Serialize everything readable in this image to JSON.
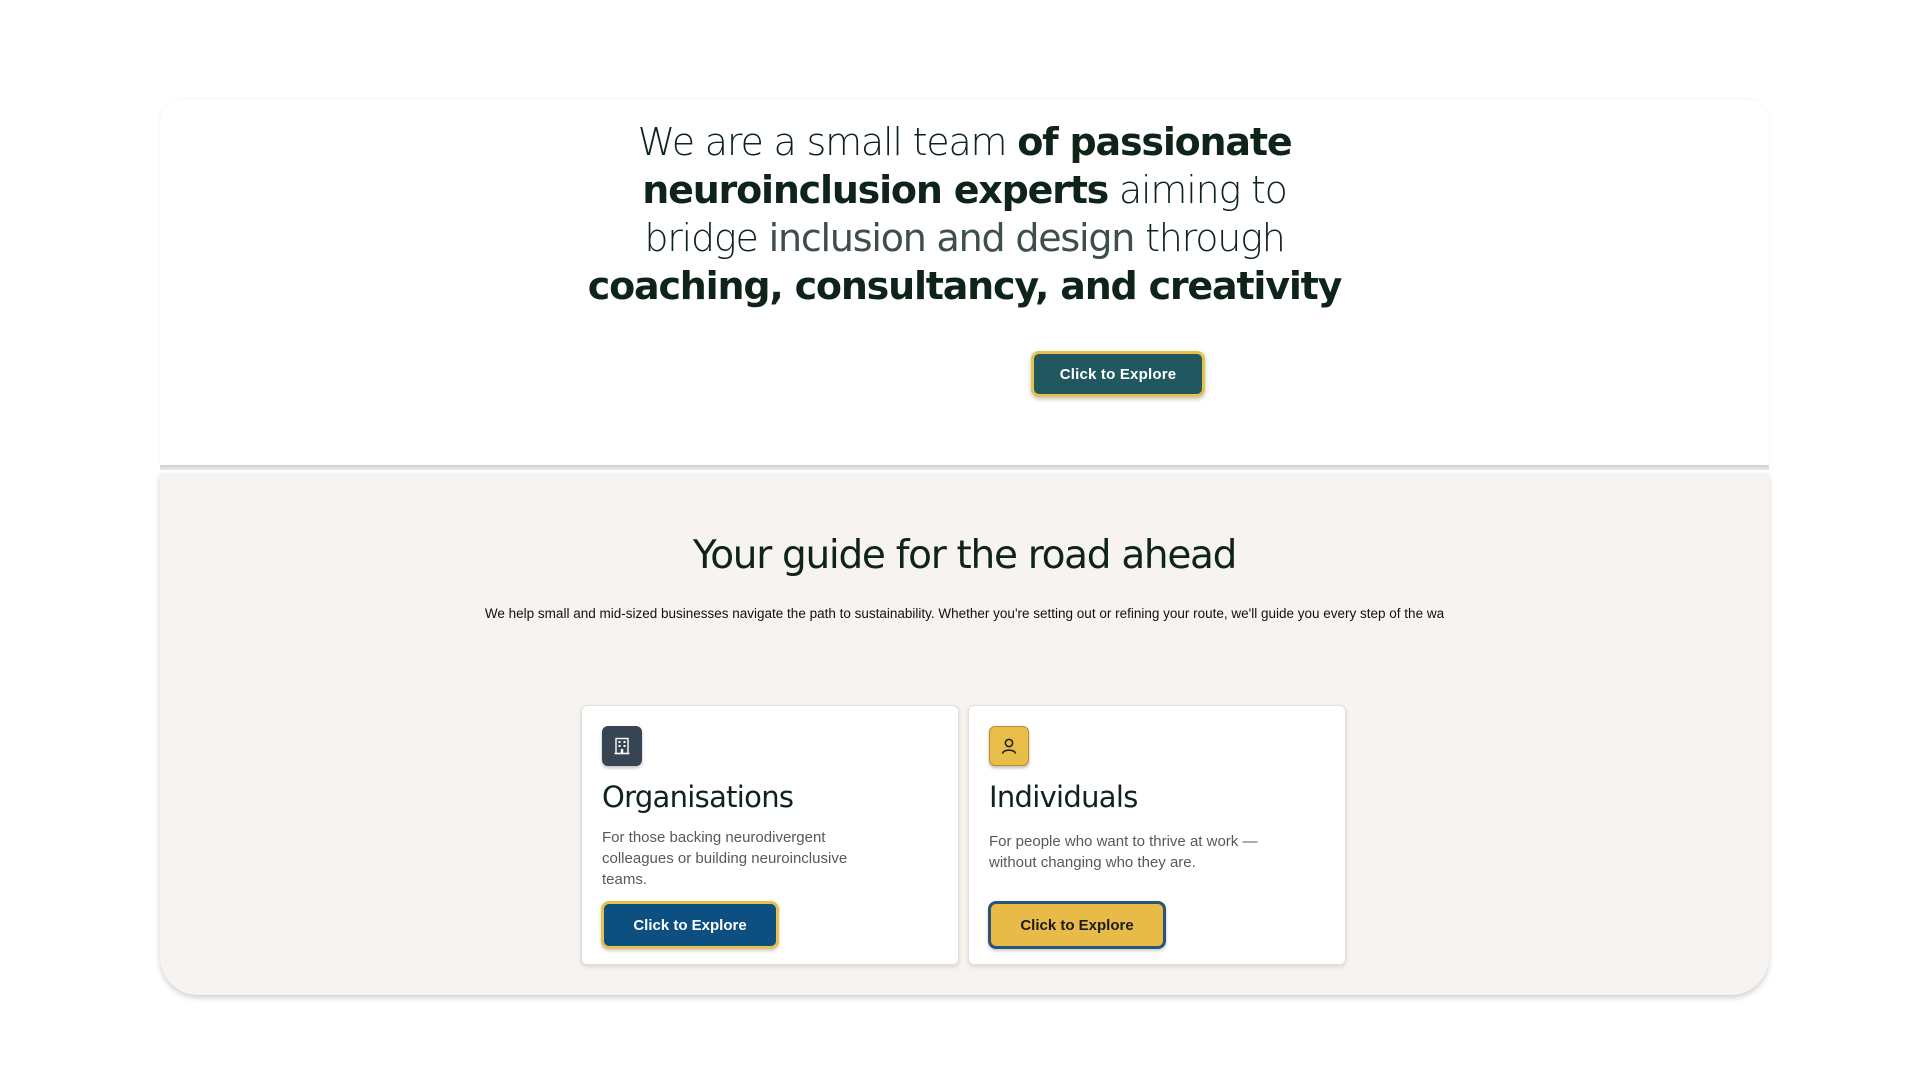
{
  "hero": {
    "heading_parts": [
      "We are a small team ",
      "of ",
      "passionate neuroinclusion experts",
      " aiming to bridge ",
      "inclusion and design",
      " through ",
      "coaching, consultancy, and creativity"
    ],
    "button_label": "Click to Explore"
  },
  "guide": {
    "title": "Your guide for the road ahead",
    "subtitle": "We help small and mid-sized businesses navigate the path to sustainability. Whether you're setting out or refining your route, we'll guide you every step of the wa",
    "cards": [
      {
        "icon": "building-icon",
        "title": "Organisations",
        "description": "For those backing neurodivergent colleagues or building neuroinclusive teams.",
        "button_label": "Click to Explore",
        "accent_color": "#0c4f80"
      },
      {
        "icon": "user-icon",
        "title": "Individuals",
        "description": "For people who want to thrive at work — without changing who they are.",
        "button_label": "Click to Explore",
        "accent_color": "#e8bb48"
      }
    ]
  },
  "colors": {
    "hero_button": "#21575f",
    "button_outline": "#e8c14b",
    "section_background": "#f7f3f0",
    "heading_text": "#0f2418"
  }
}
